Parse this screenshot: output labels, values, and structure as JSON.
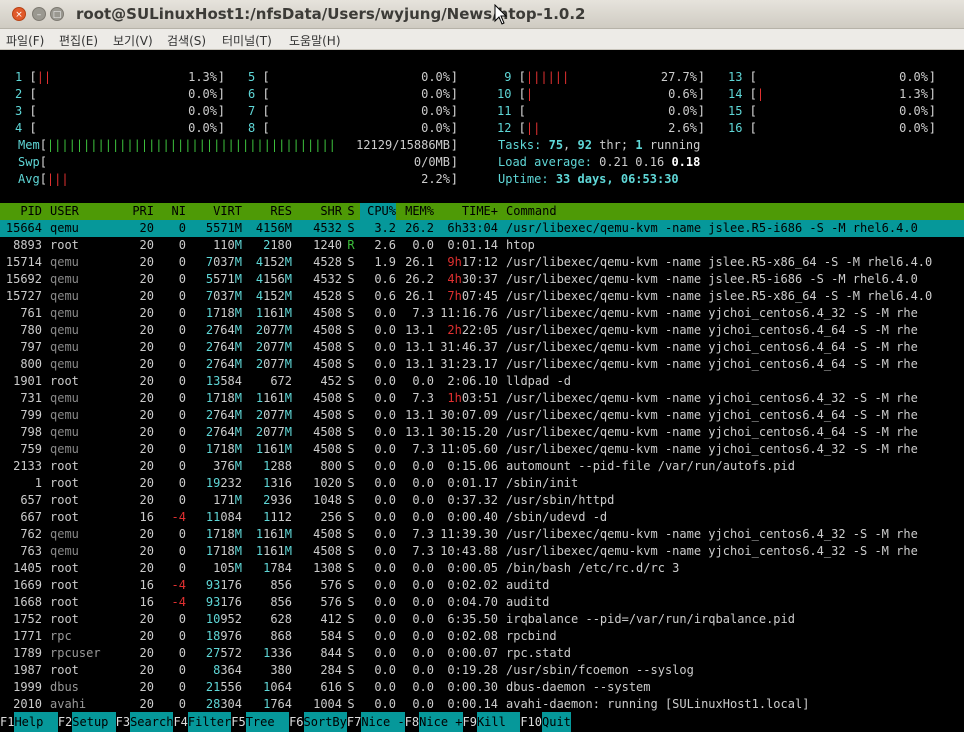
{
  "window": {
    "title": "root@SULinuxHost1:/nfsData/Users/wyjung/News/htop-1.0.2",
    "close": "×",
    "min": "–",
    "max": "□"
  },
  "menu": [
    "파일(F)",
    "편집(E)",
    "보기(V)",
    "검색(S)",
    "터미널(T)",
    "도움말(H)"
  ],
  "cpus": [
    {
      "n": "1",
      "bars": "||",
      "pct": "1.3%"
    },
    {
      "n": "2",
      "bars": "",
      "pct": "0.0%"
    },
    {
      "n": "3",
      "bars": "",
      "pct": "0.0%"
    },
    {
      "n": "4",
      "bars": "",
      "pct": "0.0%"
    },
    {
      "n": "5",
      "bars": "",
      "pct": "0.0%"
    },
    {
      "n": "6",
      "bars": "",
      "pct": "0.0%"
    },
    {
      "n": "7",
      "bars": "",
      "pct": "0.0%"
    },
    {
      "n": "8",
      "bars": "",
      "pct": "0.0%"
    },
    {
      "n": "9",
      "bars": "||||||",
      "pct": "27.7%"
    },
    {
      "n": "10",
      "bars": "|",
      "pct": "0.6%"
    },
    {
      "n": "11",
      "bars": "",
      "pct": "0.0%"
    },
    {
      "n": "12",
      "bars": "||",
      "pct": "2.6%"
    },
    {
      "n": "13",
      "bars": "",
      "pct": "0.0%"
    },
    {
      "n": "14",
      "bars": "|",
      "pct": "1.3%"
    },
    {
      "n": "15",
      "bars": "",
      "pct": "0.0%"
    },
    {
      "n": "16",
      "bars": "",
      "pct": "0.0%"
    }
  ],
  "mem": {
    "label": "Mem",
    "bars": "||||||||||||||||||||||||||||||||||||||||",
    "value": "12129/15886MB"
  },
  "swp": {
    "label": "Swp",
    "value": "0/0MB"
  },
  "avg": {
    "label": "Avg",
    "bars": "|||",
    "value": "2.2%"
  },
  "tasks": {
    "label": "Tasks:",
    "count": "75",
    "sep": ",",
    "thr": "92",
    "thr_label": "thr;",
    "running": "1",
    "running_label": "running"
  },
  "load": {
    "label": "Load average:",
    "v1": "0.21",
    "v2": "0.16",
    "v3": "0.18"
  },
  "uptime": {
    "label": "Uptime:",
    "days": "33",
    "days_label": "days,",
    "time": "06:53:30"
  },
  "columns": [
    "PID",
    "USER",
    "PRI",
    "NI",
    "VIRT",
    "RES",
    "SHR",
    "S",
    "CPU%",
    "MEM%",
    "TIME+",
    "Command"
  ],
  "processes": [
    {
      "pid": "15664",
      "user": "qemu",
      "pri": "20",
      "ni": "0",
      "virt": "5571M",
      "res": "4156M",
      "shr": "4532",
      "s": "S",
      "cpu": "3.2",
      "mem": "26.2",
      "time": "6h33:04",
      "cmd": "/usr/libexec/qemu-kvm -name jslee.R5-i686 -S -M rhel6.4.0"
    },
    {
      "pid": "8893",
      "user": "root",
      "pri": "20",
      "ni": "0",
      "virt": "110M",
      "res": "2180",
      "shr": "1240",
      "s": "R",
      "cpu": "2.6",
      "mem": "0.0",
      "time": "0:01.14",
      "cmd": "htop"
    },
    {
      "pid": "15714",
      "user": "qemu",
      "pri": "20",
      "ni": "0",
      "virt": "7037M",
      "res": "4152M",
      "shr": "4528",
      "s": "S",
      "cpu": "1.9",
      "mem": "26.1",
      "time": "9h17:12",
      "cmd": "/usr/libexec/qemu-kvm -name jslee.R5-x86_64 -S -M rhel6.4.0"
    },
    {
      "pid": "15692",
      "user": "qemu",
      "pri": "20",
      "ni": "0",
      "virt": "5571M",
      "res": "4156M",
      "shr": "4532",
      "s": "S",
      "cpu": "0.6",
      "mem": "26.2",
      "time": "4h30:37",
      "cmd": "/usr/libexec/qemu-kvm -name jslee.R5-i686 -S -M rhel6.4.0"
    },
    {
      "pid": "15727",
      "user": "qemu",
      "pri": "20",
      "ni": "0",
      "virt": "7037M",
      "res": "4152M",
      "shr": "4528",
      "s": "S",
      "cpu": "0.6",
      "mem": "26.1",
      "time": "7h07:45",
      "cmd": "/usr/libexec/qemu-kvm -name jslee.R5-x86_64 -S -M rhel6.4.0"
    },
    {
      "pid": "761",
      "user": "qemu",
      "pri": "20",
      "ni": "0",
      "virt": "1718M",
      "res": "1161M",
      "shr": "4508",
      "s": "S",
      "cpu": "0.0",
      "mem": "7.3",
      "time": "11:16.76",
      "cmd": "/usr/libexec/qemu-kvm -name yjchoi_centos6.4_32 -S -M rhe"
    },
    {
      "pid": "780",
      "user": "qemu",
      "pri": "20",
      "ni": "0",
      "virt": "2764M",
      "res": "2077M",
      "shr": "4508",
      "s": "S",
      "cpu": "0.0",
      "mem": "13.1",
      "time": "2h22:05",
      "cmd": "/usr/libexec/qemu-kvm -name yjchoi_centos6.4_64 -S -M rhe"
    },
    {
      "pid": "797",
      "user": "qemu",
      "pri": "20",
      "ni": "0",
      "virt": "2764M",
      "res": "2077M",
      "shr": "4508",
      "s": "S",
      "cpu": "0.0",
      "mem": "13.1",
      "time": "31:46.37",
      "cmd": "/usr/libexec/qemu-kvm -name yjchoi_centos6.4_64 -S -M rhe"
    },
    {
      "pid": "800",
      "user": "qemu",
      "pri": "20",
      "ni": "0",
      "virt": "2764M",
      "res": "2077M",
      "shr": "4508",
      "s": "S",
      "cpu": "0.0",
      "mem": "13.1",
      "time": "31:23.17",
      "cmd": "/usr/libexec/qemu-kvm -name yjchoi_centos6.4_64 -S -M rhe"
    },
    {
      "pid": "1901",
      "user": "root",
      "pri": "20",
      "ni": "0",
      "virt": "13584",
      "res": "672",
      "shr": "452",
      "s": "S",
      "cpu": "0.0",
      "mem": "0.0",
      "time": "2:06.10",
      "cmd": "lldpad -d"
    },
    {
      "pid": "731",
      "user": "qemu",
      "pri": "20",
      "ni": "0",
      "virt": "1718M",
      "res": "1161M",
      "shr": "4508",
      "s": "S",
      "cpu": "0.0",
      "mem": "7.3",
      "time": "1h03:51",
      "cmd": "/usr/libexec/qemu-kvm -name yjchoi_centos6.4_32 -S -M rhe"
    },
    {
      "pid": "799",
      "user": "qemu",
      "pri": "20",
      "ni": "0",
      "virt": "2764M",
      "res": "2077M",
      "shr": "4508",
      "s": "S",
      "cpu": "0.0",
      "mem": "13.1",
      "time": "30:07.09",
      "cmd": "/usr/libexec/qemu-kvm -name yjchoi_centos6.4_64 -S -M rhe"
    },
    {
      "pid": "798",
      "user": "qemu",
      "pri": "20",
      "ni": "0",
      "virt": "2764M",
      "res": "2077M",
      "shr": "4508",
      "s": "S",
      "cpu": "0.0",
      "mem": "13.1",
      "time": "30:15.20",
      "cmd": "/usr/libexec/qemu-kvm -name yjchoi_centos6.4_64 -S -M rhe"
    },
    {
      "pid": "759",
      "user": "qemu",
      "pri": "20",
      "ni": "0",
      "virt": "1718M",
      "res": "1161M",
      "shr": "4508",
      "s": "S",
      "cpu": "0.0",
      "mem": "7.3",
      "time": "11:05.60",
      "cmd": "/usr/libexec/qemu-kvm -name yjchoi_centos6.4_32 -S -M rhe"
    },
    {
      "pid": "2133",
      "user": "root",
      "pri": "20",
      "ni": "0",
      "virt": "376M",
      "res": "1288",
      "shr": "800",
      "s": "S",
      "cpu": "0.0",
      "mem": "0.0",
      "time": "0:15.06",
      "cmd": "automount --pid-file /var/run/autofs.pid"
    },
    {
      "pid": "1",
      "user": "root",
      "pri": "20",
      "ni": "0",
      "virt": "19232",
      "res": "1316",
      "shr": "1020",
      "s": "S",
      "cpu": "0.0",
      "mem": "0.0",
      "time": "0:01.17",
      "cmd": "/sbin/init"
    },
    {
      "pid": "657",
      "user": "root",
      "pri": "20",
      "ni": "0",
      "virt": "171M",
      "res": "2936",
      "shr": "1048",
      "s": "S",
      "cpu": "0.0",
      "mem": "0.0",
      "time": "0:37.32",
      "cmd": "/usr/sbin/httpd"
    },
    {
      "pid": "667",
      "user": "root",
      "pri": "16",
      "ni": "-4",
      "virt": "11084",
      "res": "1112",
      "shr": "256",
      "s": "S",
      "cpu": "0.0",
      "mem": "0.0",
      "time": "0:00.40",
      "cmd": "/sbin/udevd -d"
    },
    {
      "pid": "762",
      "user": "qemu",
      "pri": "20",
      "ni": "0",
      "virt": "1718M",
      "res": "1161M",
      "shr": "4508",
      "s": "S",
      "cpu": "0.0",
      "mem": "7.3",
      "time": "11:39.30",
      "cmd": "/usr/libexec/qemu-kvm -name yjchoi_centos6.4_32 -S -M rhe"
    },
    {
      "pid": "763",
      "user": "qemu",
      "pri": "20",
      "ni": "0",
      "virt": "1718M",
      "res": "1161M",
      "shr": "4508",
      "s": "S",
      "cpu": "0.0",
      "mem": "7.3",
      "time": "10:43.88",
      "cmd": "/usr/libexec/qemu-kvm -name yjchoi_centos6.4_32 -S -M rhe"
    },
    {
      "pid": "1405",
      "user": "root",
      "pri": "20",
      "ni": "0",
      "virt": "105M",
      "res": "1784",
      "shr": "1308",
      "s": "S",
      "cpu": "0.0",
      "mem": "0.0",
      "time": "0:00.05",
      "cmd": "/bin/bash /etc/rc.d/rc 3"
    },
    {
      "pid": "1669",
      "user": "root",
      "pri": "16",
      "ni": "-4",
      "virt": "93176",
      "res": "856",
      "shr": "576",
      "s": "S",
      "cpu": "0.0",
      "mem": "0.0",
      "time": "0:02.02",
      "cmd": "auditd"
    },
    {
      "pid": "1668",
      "user": "root",
      "pri": "16",
      "ni": "-4",
      "virt": "93176",
      "res": "856",
      "shr": "576",
      "s": "S",
      "cpu": "0.0",
      "mem": "0.0",
      "time": "0:04.70",
      "cmd": "auditd"
    },
    {
      "pid": "1752",
      "user": "root",
      "pri": "20",
      "ni": "0",
      "virt": "10952",
      "res": "628",
      "shr": "412",
      "s": "S",
      "cpu": "0.0",
      "mem": "0.0",
      "time": "6:35.50",
      "cmd": "irqbalance --pid=/var/run/irqbalance.pid"
    },
    {
      "pid": "1771",
      "user": "rpc",
      "pri": "20",
      "ni": "0",
      "virt": "18976",
      "res": "868",
      "shr": "584",
      "s": "S",
      "cpu": "0.0",
      "mem": "0.0",
      "time": "0:02.08",
      "cmd": "rpcbind"
    },
    {
      "pid": "1789",
      "user": "rpcuser",
      "pri": "20",
      "ni": "0",
      "virt": "27572",
      "res": "1336",
      "shr": "844",
      "s": "S",
      "cpu": "0.0",
      "mem": "0.0",
      "time": "0:00.07",
      "cmd": "rpc.statd"
    },
    {
      "pid": "1987",
      "user": "root",
      "pri": "20",
      "ni": "0",
      "virt": "8364",
      "res": "380",
      "shr": "284",
      "s": "S",
      "cpu": "0.0",
      "mem": "0.0",
      "time": "0:19.28",
      "cmd": "/usr/sbin/fcoemon --syslog"
    },
    {
      "pid": "1999",
      "user": "dbus",
      "pri": "20",
      "ni": "0",
      "virt": "21556",
      "res": "1064",
      "shr": "616",
      "s": "S",
      "cpu": "0.0",
      "mem": "0.0",
      "time": "0:00.30",
      "cmd": "dbus-daemon --system"
    },
    {
      "pid": "2010",
      "user": "avahi",
      "pri": "20",
      "ni": "0",
      "virt": "28304",
      "res": "1764",
      "shr": "1004",
      "s": "S",
      "cpu": "0.0",
      "mem": "0.0",
      "time": "0:00.14",
      "cmd": "avahi-daemon: running [SULinuxHost1.local]"
    }
  ],
  "fkeys": [
    {
      "key": "F1",
      "label": "Help  "
    },
    {
      "key": "F2",
      "label": "Setup "
    },
    {
      "key": "F3",
      "label": "Search"
    },
    {
      "key": "F4",
      "label": "Filter"
    },
    {
      "key": "F5",
      "label": "Tree  "
    },
    {
      "key": "F6",
      "label": "SortBy"
    },
    {
      "key": "F7",
      "label": "Nice -"
    },
    {
      "key": "F8",
      "label": "Nice +"
    },
    {
      "key": "F9",
      "label": "Kill  "
    },
    {
      "key": "F10",
      "label": "Quit"
    }
  ]
}
